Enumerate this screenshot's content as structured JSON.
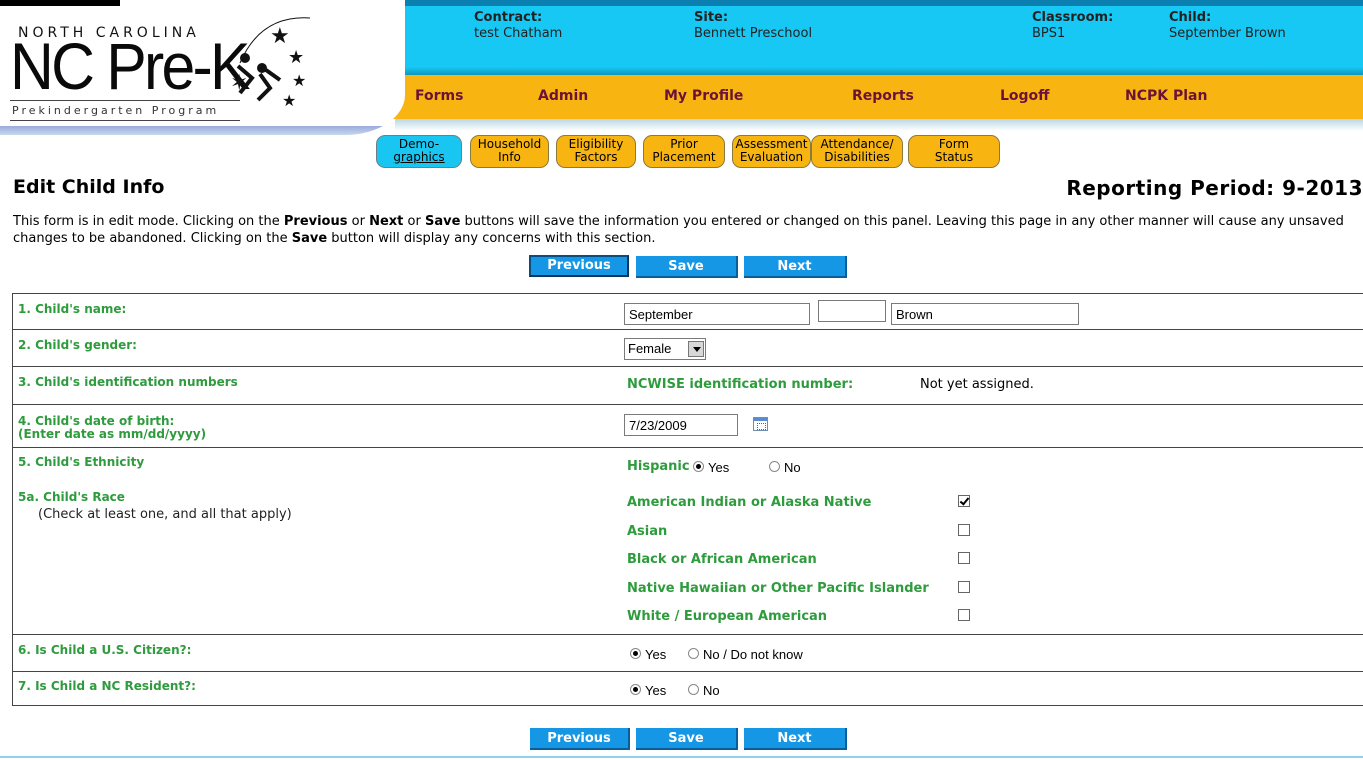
{
  "logo": {
    "top": "NORTH CAROLINA",
    "main": "NC Pre-K",
    "sub": "Prekindergarten Program"
  },
  "context": {
    "contract_label": "Contract:",
    "contract_value": "test Chatham",
    "site_label": "Site:",
    "site_value": "Bennett Preschool",
    "classroom_label": "Classroom:",
    "classroom_value": "BPS1",
    "child_label": "Child:",
    "child_value": "September Brown"
  },
  "menu": {
    "items": [
      "Forms",
      "Admin",
      "My Profile",
      "Reports",
      "Logoff",
      "NCPK Plan"
    ]
  },
  "tabs": [
    {
      "line1": "Demo-",
      "line2": "graphics"
    },
    {
      "line1": "Household",
      "line2": "Info"
    },
    {
      "line1": "Eligibility",
      "line2": "Factors"
    },
    {
      "line1": "Prior",
      "line2": "Placement"
    },
    {
      "line1": "Assessment",
      "line2": "Evaluation"
    },
    {
      "line1": "Attendance/",
      "line2": "Disabilities"
    },
    {
      "line1": "Form",
      "line2": "Status"
    }
  ],
  "page": {
    "title": "Edit Child Info",
    "period": "Reporting Period: 9-2013",
    "instructions": {
      "p1": "This form is in edit mode. Clicking on the ",
      "b1": "Previous",
      "p2": " or ",
      "b2": "Next",
      "p3": " or ",
      "b3": "Save",
      "p4": " buttons will save the information you entered or changed on this panel. Leaving this page in any other manner will cause any unsaved changes to be abandoned. Clicking on the ",
      "b4": "Save",
      "p5": " button will display any concerns with this section."
    }
  },
  "buttons": {
    "previous": "Previous",
    "save": "Save",
    "next": "Next"
  },
  "form": {
    "q1": "1. Child's name:",
    "first_name": "September",
    "middle_name": "",
    "last_name": "Brown",
    "q2": "2. Child's gender:",
    "gender": "Female",
    "q3": "3. Child's identification numbers",
    "ncwise_label": "NCWISE identification number:",
    "ncwise_value": "Not yet assigned.",
    "q4_line1": "4. Child's date of birth:",
    "q4_line2": "(Enter date as mm/dd/yyyy)",
    "dob": "7/23/2009",
    "q5": "5. Child's Ethnicity",
    "hispanic_label": "Hispanic",
    "yes": "Yes",
    "no": "No",
    "hispanic_selected": "Yes",
    "q5a": "5a. Child's Race",
    "q5a_note": "(Check at least one, and all that apply)",
    "races": [
      {
        "label": "American Indian or Alaska Native",
        "checked": true
      },
      {
        "label": "Asian",
        "checked": false
      },
      {
        "label": "Black or African American",
        "checked": false
      },
      {
        "label": "Native Hawaiian or Other Pacific Islander",
        "checked": false
      },
      {
        "label": "White / European American",
        "checked": false
      }
    ],
    "q6": "6. Is Child a U.S. Citizen?:",
    "citizen_yes": "Yes",
    "citizen_no": "No / Do not know",
    "citizen_selected": "Yes",
    "q7": "7. Is Child a NC Resident?:",
    "resident_yes": "Yes",
    "resident_no": "No",
    "resident_selected": "Yes"
  },
  "colors": {
    "info_bar": "#18c8f4",
    "menu_bar": "#f8b512",
    "menu_text": "#6b1236",
    "question_text": "#2e9b3d",
    "button": "#1597e6"
  }
}
